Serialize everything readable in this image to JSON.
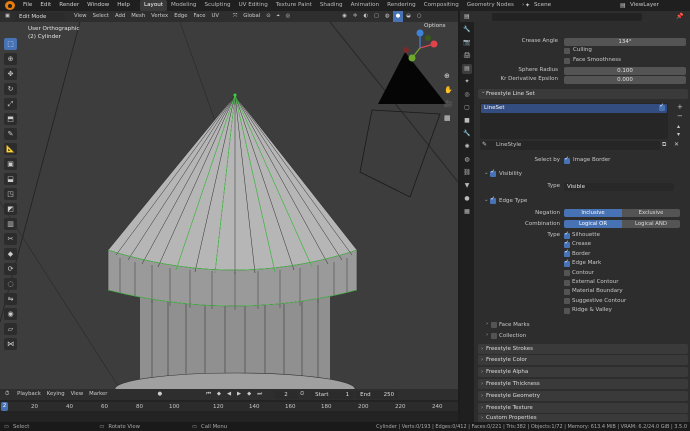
{
  "topbar": {
    "menus": [
      "File",
      "Edit",
      "Render",
      "Window",
      "Help"
    ],
    "workspaces": [
      "Layout",
      "Modeling",
      "Sculpting",
      "UV Editing",
      "Texture Paint",
      "Shading",
      "Animation",
      "Rendering",
      "Compositing",
      "Geometry Nodes"
    ],
    "active_workspace": "Layout",
    "scene": "Scene",
    "view_layer": "ViewLayer"
  },
  "viewport_header": {
    "mode": "Edit Mode",
    "menus": [
      "View",
      "Select",
      "Add",
      "Mesh",
      "Vertex",
      "Edge",
      "Face",
      "UV"
    ],
    "orientation": "Global",
    "options": "Options"
  },
  "viewport": {
    "view_name": "User Orthographic",
    "object_name": "(2) Cylinder",
    "gizmo_axes": [
      "X",
      "Y",
      "Z"
    ]
  },
  "timeline": {
    "menus": [
      "Playback",
      "Keying",
      "View",
      "Marker"
    ],
    "current_frame": "2",
    "start_label": "Start",
    "start": "1",
    "end_label": "End",
    "end": "250",
    "ruler": [
      "2",
      "20",
      "40",
      "60",
      "80",
      "100",
      "120",
      "140",
      "160",
      "180",
      "200",
      "220",
      "240"
    ]
  },
  "statusbar": {
    "left": "Select",
    "mid": "Rotate View",
    "menu": "Call Menu",
    "stats": "Cylinder | Verts:0/193 | Edges:0/412 | Faces:0/221 | Tris:382 | Objects:1/72 | Memory: 613.4 MiB | VRAM: 6.2/24.0 GiB | 3.5.0"
  },
  "props": {
    "crease_angle_label": "Crease Angle",
    "crease_angle": "134°",
    "culling": "Culling",
    "face_smoothness": "Face Smoothness",
    "sphere_radius_label": "Sphere Radius",
    "sphere_radius": "0.100",
    "kr_label": "Kr Derivative Epsilon",
    "kr": "0.000",
    "lineset_panel": "Freestyle Line Set",
    "lineset_item": "LineSet",
    "linestyle": "LineStyle",
    "select_by_label": "Select by",
    "image_border": "Image Border",
    "visibility": "Visibility",
    "type_label": "Type",
    "type_value": "Visible",
    "edge_type": "Edge Type",
    "negation_label": "Negation",
    "negation_opts": [
      "Inclusive",
      "Exclusive"
    ],
    "combination_label": "Combination",
    "combination_opts": [
      "Logical OR",
      "Logical AND"
    ],
    "edge_type_label": "Type",
    "edge_types": [
      {
        "name": "Silhouette",
        "on": true
      },
      {
        "name": "Crease",
        "on": true
      },
      {
        "name": "Border",
        "on": true
      },
      {
        "name": "Edge Mark",
        "on": true
      },
      {
        "name": "Contour",
        "on": false
      },
      {
        "name": "External Contour",
        "on": false
      },
      {
        "name": "Material Boundary",
        "on": false
      },
      {
        "name": "Suggestive Contour",
        "on": false
      },
      {
        "name": "Ridge & Valley",
        "on": false
      }
    ],
    "face_marks": "Face Marks",
    "collection": "Collection",
    "panels": [
      "Freestyle Strokes",
      "Freestyle Color",
      "Freestyle Alpha",
      "Freestyle Thickness",
      "Freestyle Geometry",
      "Freestyle Texture",
      "Custom Properties"
    ]
  },
  "colors": {
    "accent": "#4772b3",
    "wire_select": "#55cc55",
    "orange": "#e87d0d"
  }
}
